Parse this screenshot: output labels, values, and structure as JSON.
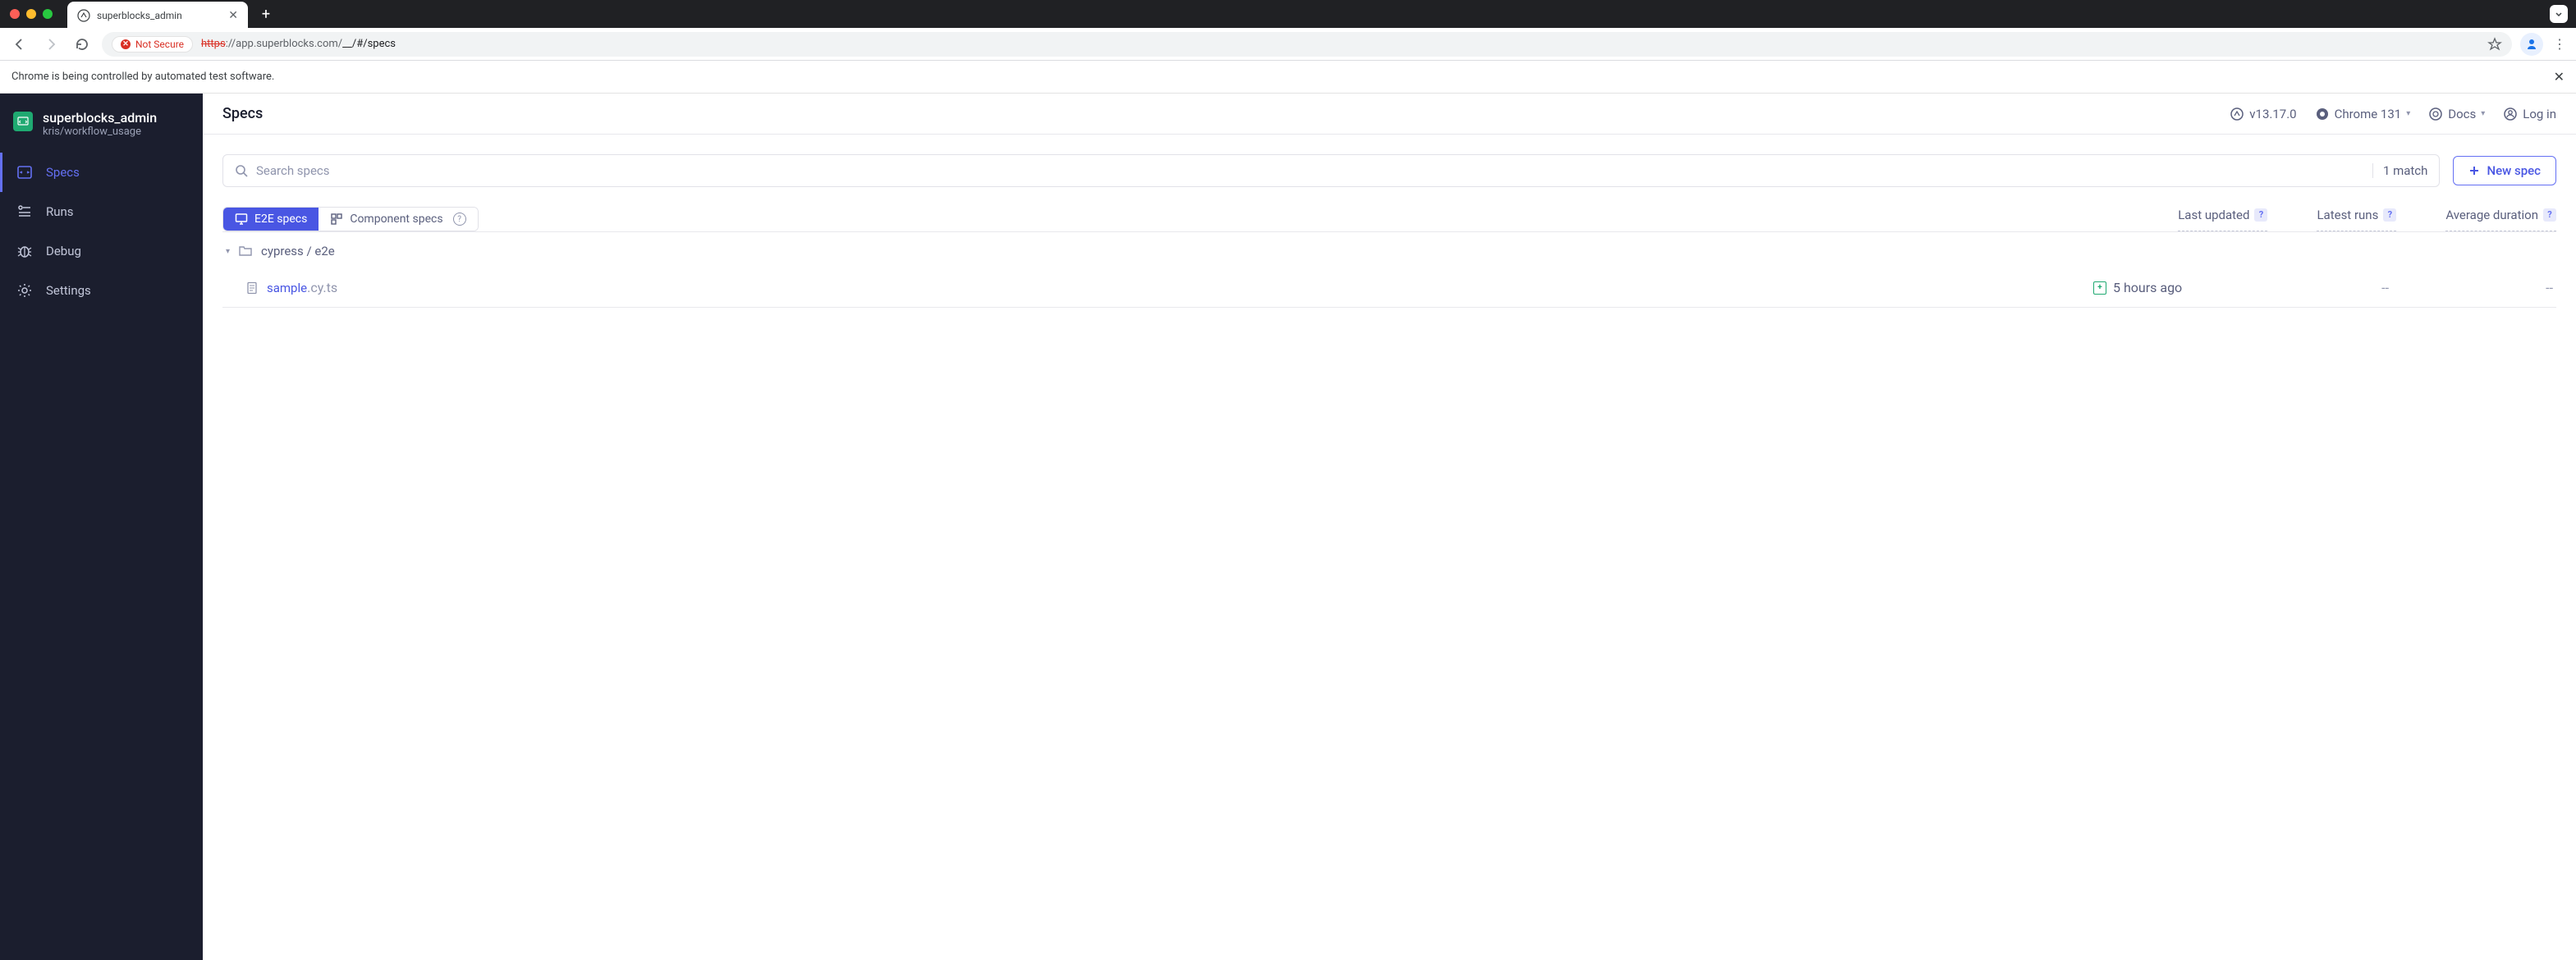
{
  "browser": {
    "tab_title": "superblocks_admin",
    "not_secure_label": "Not Secure",
    "url_strike": "https",
    "url_host": "://app.superblocks.com/",
    "url_path": "__/#/specs",
    "automation_text": "Chrome is being controlled by automated test software."
  },
  "project": {
    "name": "superblocks_admin",
    "branch": "kris/workflow_usage"
  },
  "sidebar": [
    {
      "label": "Specs"
    },
    {
      "label": "Runs"
    },
    {
      "label": "Debug"
    },
    {
      "label": "Settings"
    }
  ],
  "topbar": {
    "title": "Specs",
    "version": "v13.17.0",
    "browser_label": "Chrome 131",
    "docs_label": "Docs",
    "login_label": "Log in"
  },
  "search": {
    "placeholder": "Search specs",
    "match_count": "1 match",
    "new_spec_label": "New spec"
  },
  "spec_tabs": {
    "e2e": "E2E specs",
    "component": "Component specs"
  },
  "columns": {
    "last_updated": "Last updated",
    "latest_runs": "Latest runs",
    "avg_duration": "Average duration"
  },
  "folder": {
    "path": "cypress / e2e"
  },
  "files": [
    {
      "name": "sample",
      "ext": ".cy.ts",
      "last_updated": "5 hours ago",
      "latest_runs": "--",
      "avg_duration": "--"
    }
  ]
}
